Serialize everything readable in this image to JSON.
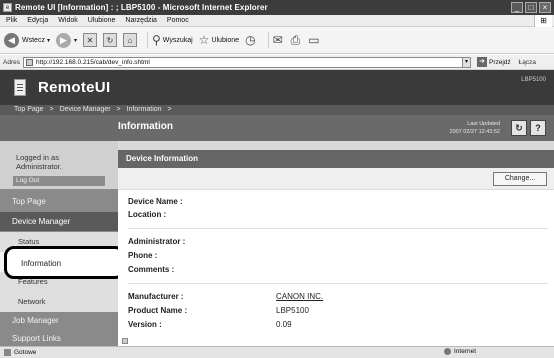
{
  "browser": {
    "title": "Remote UI [Information] : ; LBP5100 - Microsoft Internet Explorer",
    "window_buttons": [
      "_",
      "□",
      "×"
    ],
    "menu": [
      "Plik",
      "Edycja",
      "Widok",
      "Ulubione",
      "Narzędzia",
      "Pomoc"
    ],
    "toolbar": {
      "back_label": "Wstecz",
      "search_label": "Wyszukaj",
      "favorites_label": "Ulubione"
    },
    "address": {
      "label": "Adres",
      "url": "http://192.168.0.215/cab/dev_info.shtml",
      "go_label": "Przejdź",
      "links_label": "Łącza"
    },
    "status": {
      "left_text": "Gotowe",
      "zone_text": "Internet"
    }
  },
  "remote_ui": {
    "logo_text": "RemoteUI",
    "printer_name": "LBP5100",
    "breadcrumb": [
      "Top Page",
      "Device Manager",
      "Information"
    ],
    "breadcrumb_separator": ">",
    "page_title": "Information",
    "last_updated_label": "Last Updated",
    "last_updated_value": "2007 02/27 12:43:52",
    "refresh_icon": "↻",
    "help_icon": "?"
  },
  "sidebar": {
    "login_text": "Logged in as Administrator.",
    "logout_label": "Log Out",
    "top_page": "Top Page",
    "device_manager": "Device Manager",
    "sub_items": {
      "status": "Status",
      "information": "Information",
      "features": "Features",
      "network": "Network"
    },
    "job_manager": "Job Manager",
    "support_links": "Support Links"
  },
  "device_info": {
    "heading": "Device Information",
    "change_label": "Change...",
    "fields": {
      "device_name_label": "Device Name :",
      "device_name_value": "",
      "location_label": "Location :",
      "location_value": "",
      "administrator_label": "Administrator :",
      "administrator_value": "",
      "phone_label": "Phone :",
      "phone_value": "",
      "comments_label": "Comments :",
      "comments_value": "",
      "manufacturer_label": "Manufacturer :",
      "manufacturer_value": "CANON INC.",
      "product_name_label": "Product Name :",
      "product_name_value": "LBP5100",
      "version_label": "Version :",
      "version_value": "0.09"
    }
  }
}
